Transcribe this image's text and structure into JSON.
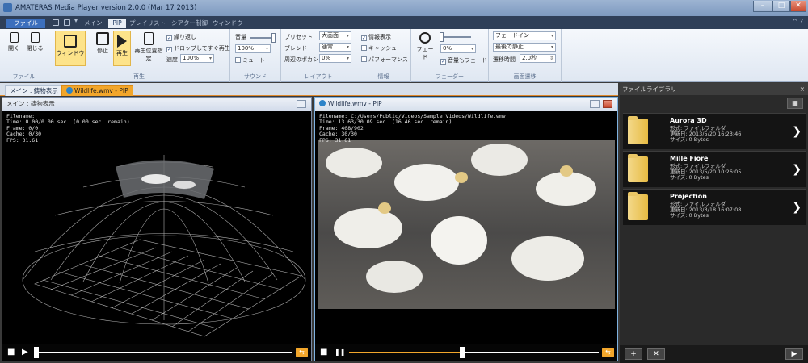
{
  "window": {
    "title": "AMATERAS Media Player version 2.0.0 (Mar 17 2013)",
    "min": "–",
    "max": "□",
    "close": "✕"
  },
  "ribbon_tabs": {
    "file": "ファイル",
    "qa3": "▾",
    "items": [
      "メイン",
      "PIP",
      "プレイリスト",
      "シアター制御",
      "ウィンドウ"
    ],
    "active_index": 1,
    "help": "^ ?"
  },
  "ribbon": {
    "file_group": {
      "open": "開く",
      "close": "閉じる",
      "label": "ファイル"
    },
    "play_group": {
      "window": "ウィンドウ",
      "stop": "停止",
      "play": "再生",
      "play_pos": "再生位置指定",
      "repeat": "繰り返し",
      "drop_play": "ドロップしてすぐ再生",
      "speed_label": "速度",
      "speed_value": "100%",
      "label": "再生",
      "repeat_checked": true,
      "drop_checked": true
    },
    "sound_group": {
      "volume_label": "音量",
      "volume_value": "100%",
      "mute": "ミュート",
      "label": "サウンド",
      "volume_level": 1.0
    },
    "layout_group": {
      "preset_label": "プリセット",
      "preset_value": "大画面",
      "blend_label": "ブレンド",
      "blend_value": "通常",
      "blur_label": "周辺のボカシ",
      "blur_value": "0%",
      "label": "レイアウト"
    },
    "info_group": {
      "info_display": "情報表示",
      "cache": "キャッシュ",
      "performance": "パフォーマンス",
      "label": "情報",
      "info_checked": true
    },
    "fader_group": {
      "fade": "フェード",
      "fade_value": "0%",
      "volume_fade": "音量もフェード",
      "label": "フェーダー",
      "fade_level": 0.0,
      "volume_fade_checked": true
    },
    "transition_group": {
      "fade_in": "フェードイン",
      "last_stop": "最後で静止",
      "time_label": "遷移時間",
      "time_value": "2.0秒",
      "label": "画面遷移"
    }
  },
  "panel_tabs": [
    "メイン : 鋳物表示",
    "Wildlife.wmv - PIP"
  ],
  "main_pane": {
    "header": "メイン : 鋳物表示",
    "overlay": "Filename:\nTime: 0.00/0.00 sec. (0.00 sec. remain)\nFrame: 0/0\nCache: 0/30\nFPS: 31.61",
    "progress": 0.0
  },
  "pip_pane": {
    "header": "Wildlife.wmv - PIP",
    "overlay": "Filename: C:/Users/Public/Videos/Sample Videos/Wildlife.wmv\nTime: 13.63/30.09 sec. (16.46 sec. remain)\nFrame: 408/902\nCache: 30/30\nFPS: 31.61",
    "progress": 0.453
  },
  "library": {
    "title": "ファイルライブラリ",
    "items": [
      {
        "name": "Aurora 3D",
        "info": "形式: ファイルフォルダ\n更新日: 2013/5/20 16:23:46\nサイズ: 0 Bytes"
      },
      {
        "name": "Mille Fiore",
        "info": "形式: ファイルフォルダ\n更新日: 2013/5/20 10:26:05\nサイズ: 0 Bytes"
      },
      {
        "name": "Projection",
        "info": "形式: ファイルフォルダ\n更新日: 2013/3/18 16:07:08\nサイズ: 0 Bytes"
      }
    ]
  },
  "icons": {
    "play": "▶",
    "stop": "■",
    "pause": "❚❚",
    "loop": "⇆",
    "chevron": "❯",
    "grid": "▦",
    "add": "+",
    "delete": "✕",
    "close": "×"
  },
  "colors": {
    "accent": "#f2a62b",
    "ribbon_blue": "#3c6fbd",
    "library_bg": "#2a2a2a"
  }
}
